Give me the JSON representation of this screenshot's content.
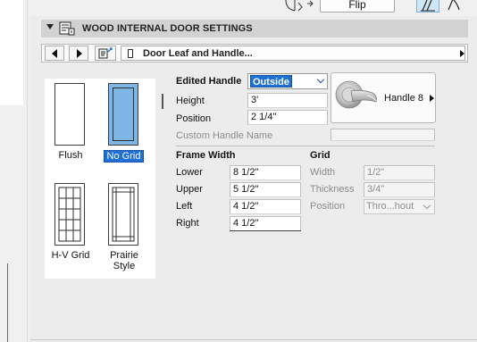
{
  "toolbar": {
    "flip_label": "Flip",
    "door_swing_icon": "door-swing-icon",
    "view_icons": [
      "plan-view-icon",
      "section-view-icon"
    ]
  },
  "panel": {
    "title": "WOOD INTERNAL DOOR SETTINGS",
    "collapse_icon": "chevron-down-icon",
    "settings_icon": "door-settings-icon"
  },
  "nav": {
    "prev_icon": "chevron-left-icon",
    "next_icon": "chevron-right-icon",
    "page_list_icon": "page-list-icon",
    "page_label": "Door Leaf and Handle...",
    "page_icon": "door-leaf-icon"
  },
  "grid_styles": [
    {
      "label": "Flush",
      "selected": false
    },
    {
      "label": "No Grid",
      "selected": true
    },
    {
      "label": "H-V Grid",
      "selected": false
    },
    {
      "label": "Prairie Style",
      "label_line1": "Prairie",
      "label_line2": "Style",
      "selected": false
    }
  ],
  "handle": {
    "edited_handle_label": "Edited Handle",
    "edited_handle_value": "Outside",
    "height_label": "Height",
    "height_value": "3'",
    "position_label": "Position",
    "position_value": "2 1/4\"",
    "custom_name_label": "Custom Handle Name",
    "custom_name_value": "",
    "button_label": "Handle 8",
    "button_icon": "door-handle-icon"
  },
  "frame_width": {
    "title": "Frame Width",
    "lower_label": "Lower",
    "lower_value": "8 1/2\"",
    "upper_label": "Upper",
    "upper_value": "5 1/2\"",
    "left_label": "Left",
    "left_value": "4 1/2\"",
    "right_label": "Right",
    "right_value": "4 1/2\""
  },
  "grid": {
    "title": "Grid",
    "width_label": "Width",
    "width_value": "1/2\"",
    "thickness_label": "Thickness",
    "thickness_value": "3/4\"",
    "position_label": "Position",
    "position_value": "Thro...hout"
  },
  "colors": {
    "selection_blue": "#1e6fd6",
    "thumb_selected_fill": "#7db6e6",
    "header_bg": "#d2d2d2",
    "disabled_text": "#8c8c8c"
  }
}
